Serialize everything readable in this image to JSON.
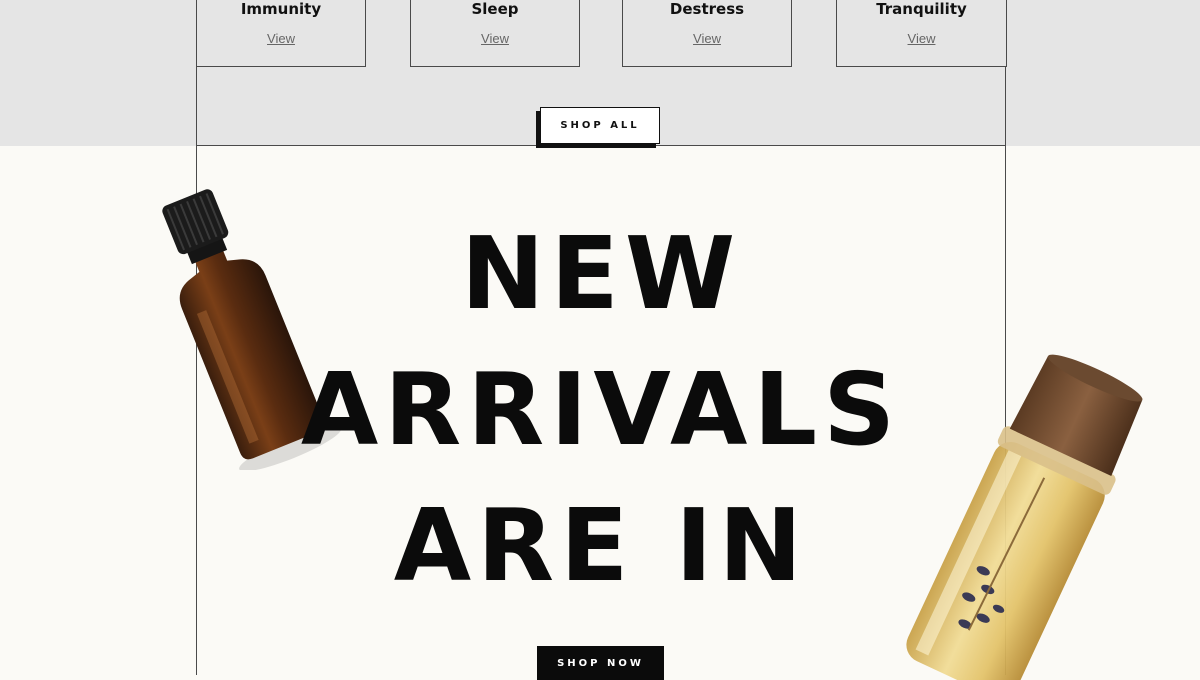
{
  "categories": [
    {
      "title": "Immunity",
      "link": "View"
    },
    {
      "title": "Sleep",
      "link": "View"
    },
    {
      "title": "Destress",
      "link": "View"
    },
    {
      "title": "Tranquility",
      "link": "View"
    }
  ],
  "shop_all_label": "SHOP ALL",
  "headline": {
    "line1": "NEW",
    "line2": "ARRIVALS",
    "line3": "ARE IN"
  },
  "shop_now_label": "SHOP NOW",
  "colors": {
    "top_band": "#e5e5e5",
    "page_bg": "#fbfaf6",
    "text": "#0b0b0b"
  },
  "decor": {
    "left_image": "amber-dropper-bottle",
    "right_image": "cork-glass-vial"
  }
}
